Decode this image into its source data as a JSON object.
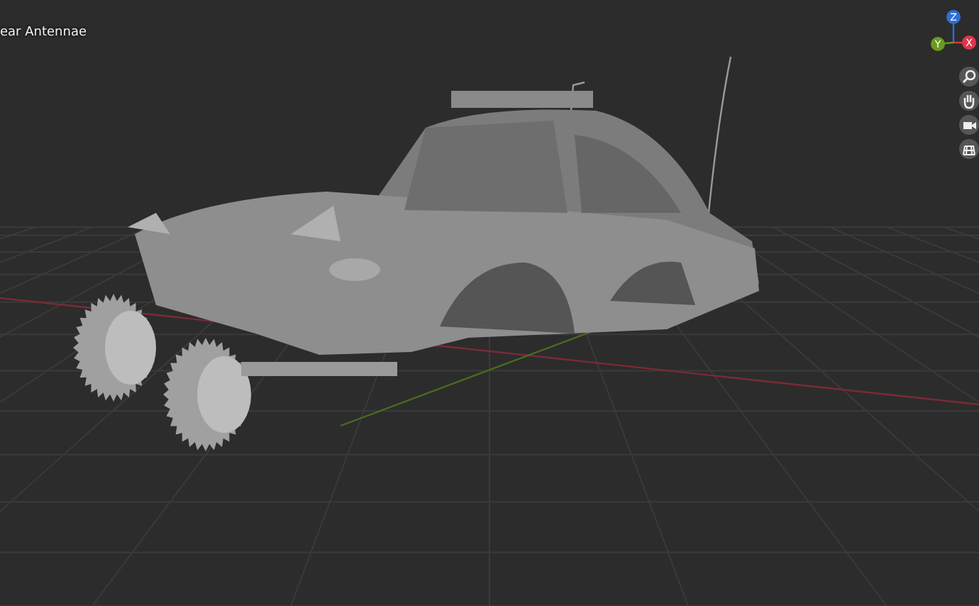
{
  "object_label": "ear Antennae",
  "gizmo": {
    "axes": [
      {
        "label": "Z",
        "color": "#2f6fd6"
      },
      {
        "label": "Y",
        "color": "#6a9a1f"
      },
      {
        "label": "X",
        "color": "#e0344a"
      }
    ]
  }
}
